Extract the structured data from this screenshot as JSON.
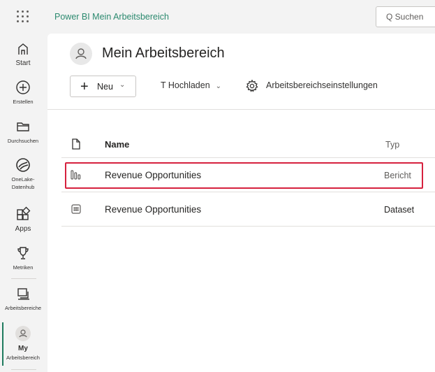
{
  "topbar": {
    "product_title": "Power BI Mein Arbeitsbereich",
    "search_placeholder": "Q Suchen"
  },
  "nav": {
    "items": [
      {
        "label": "Start",
        "icon": "home-icon"
      },
      {
        "label": "Erstellen",
        "icon": "create-plus-icon"
      },
      {
        "label": "Durchsuchen",
        "icon": "folder-icon"
      },
      {
        "label": "OneLake-Datenhub",
        "label_line1": "OneLake-",
        "label_line2": "Datenhub",
        "icon": "onelake-icon"
      },
      {
        "label": "Apps",
        "icon": "apps-icon"
      },
      {
        "label": "Metriken",
        "icon": "trophy-icon"
      },
      {
        "label": "Arbeitsbereiche",
        "icon": "workspaces-icon"
      },
      {
        "label_line1": "My",
        "label_line2": "Arbeitsbereich",
        "icon": "avatar-icon"
      }
    ]
  },
  "workspace": {
    "title": "Mein Arbeitsbereich"
  },
  "toolbar": {
    "new_label": "Neu",
    "upload_label": "T Hochladen",
    "settings_label": "Arbeitsbereichseinstellungen"
  },
  "table": {
    "columns": {
      "name": "Name",
      "type": "Typ"
    },
    "rows": [
      {
        "name": "Revenue Opportunities",
        "type": "Bericht",
        "icon": "report-icon",
        "highlighted": true
      },
      {
        "name": "Revenue Opportunities",
        "type": "Dataset",
        "icon": "dataset-icon",
        "highlighted": false
      }
    ]
  },
  "colors": {
    "accent": "#2c8a6f",
    "highlight_border": "#d6213e",
    "nav_active": "#1e7a5e"
  }
}
